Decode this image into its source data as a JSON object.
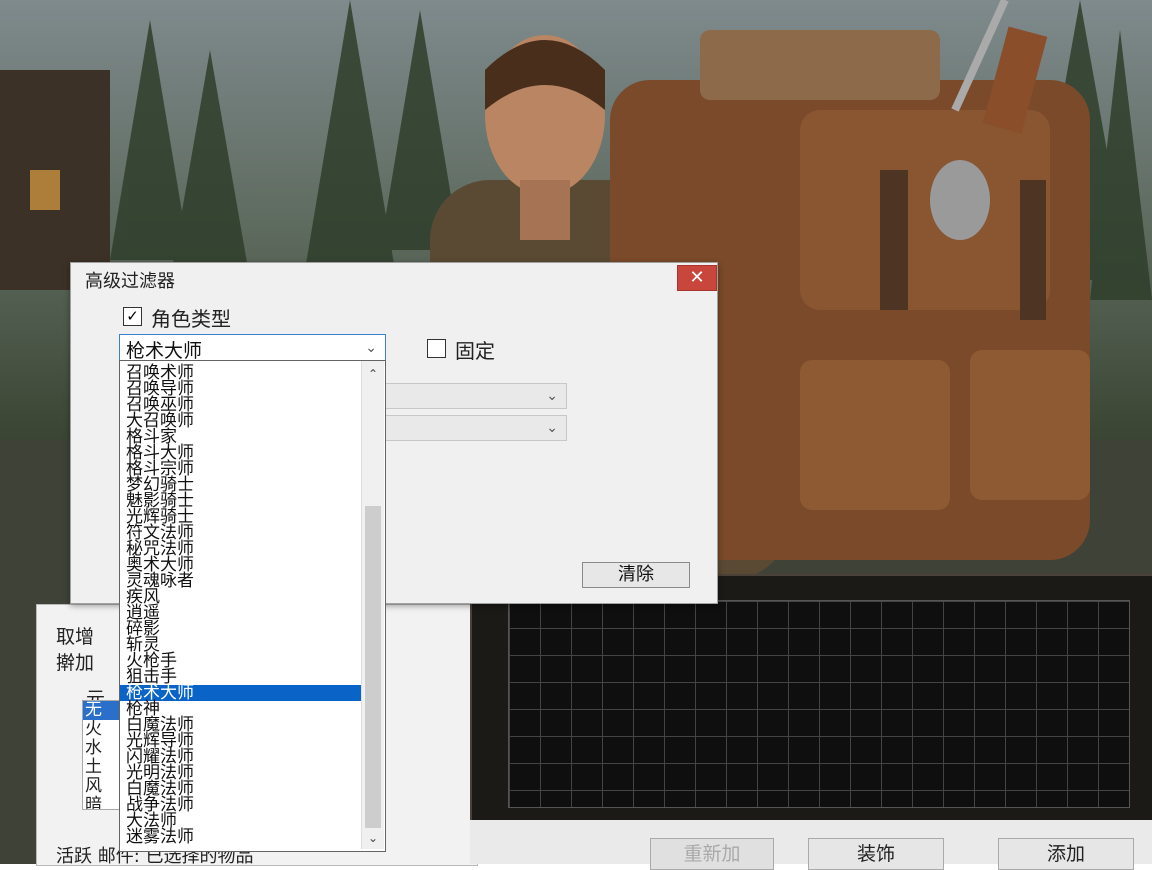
{
  "filter_dialog": {
    "title": "高级过滤器",
    "close_glyph": "✕",
    "role_type_label": "角色类型",
    "role_type_checked": "✓",
    "fixed_label": "固定",
    "selected_class": "枪术大师",
    "clear_button": "清除"
  },
  "class_dropdown": {
    "items": [
      "召唤术师",
      "召唤导师",
      "召唤巫师",
      "大召唤师",
      "格斗家",
      "格斗大师",
      "格斗宗师",
      "梦幻骑士",
      "魅影骑士",
      "光辉骑士",
      "符文法师",
      "秘咒法师",
      "奥术大师",
      "灵魂咏者",
      "疾风",
      "逍遥",
      "碎影",
      "斩灵",
      "火枪手",
      "狙击手",
      "枪术大师",
      "枪神",
      "白魔法师",
      "光辉导师",
      "闪耀法师",
      "光明法师",
      "白魔法师",
      "战争法师",
      "大法师",
      "迷雾法师"
    ],
    "selected_index": 20,
    "scroll_up": "⌃",
    "scroll_down": "⌄"
  },
  "background_panel": {
    "label_1": "取增",
    "label_2": "擀加",
    "label_3": "元",
    "element_list": [
      "无",
      "火",
      "水",
      "土",
      "风",
      "暗"
    ],
    "status_text": "活跃  邮件:  已选择的物品"
  },
  "bottom_buttons": {
    "btn1": "重新加",
    "btn2": "装饰",
    "btn3": "添加"
  },
  "chevron": "⌄"
}
